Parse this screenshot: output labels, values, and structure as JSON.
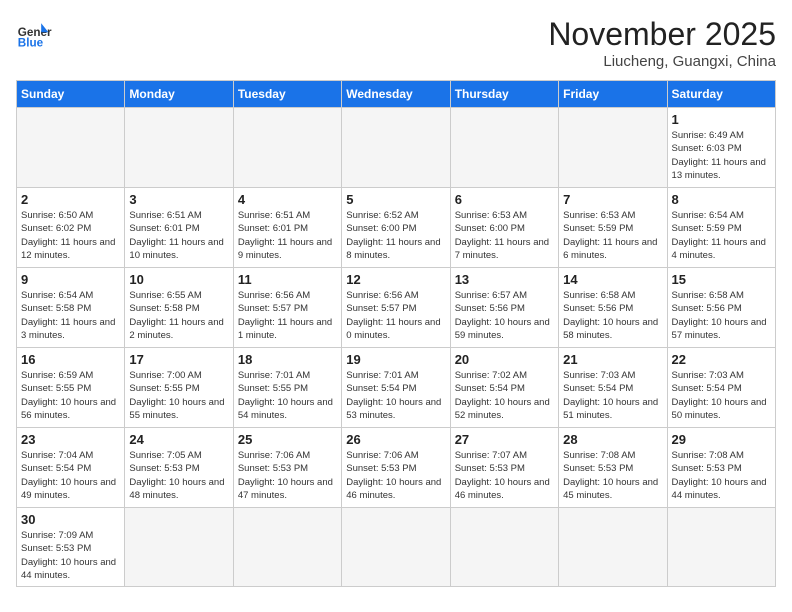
{
  "header": {
    "logo_general": "General",
    "logo_blue": "Blue",
    "month_year": "November 2025",
    "location": "Liucheng, Guangxi, China"
  },
  "weekdays": [
    "Sunday",
    "Monday",
    "Tuesday",
    "Wednesday",
    "Thursday",
    "Friday",
    "Saturday"
  ],
  "weeks": [
    [
      {
        "day": "",
        "empty": true
      },
      {
        "day": "",
        "empty": true
      },
      {
        "day": "",
        "empty": true
      },
      {
        "day": "",
        "empty": true
      },
      {
        "day": "",
        "empty": true
      },
      {
        "day": "",
        "empty": true
      },
      {
        "day": "1",
        "sunrise": "6:49 AM",
        "sunset": "6:03 PM",
        "daylight": "11 hours and 13 minutes."
      }
    ],
    [
      {
        "day": "2",
        "sunrise": "6:50 AM",
        "sunset": "6:02 PM",
        "daylight": "11 hours and 12 minutes."
      },
      {
        "day": "3",
        "sunrise": "6:51 AM",
        "sunset": "6:01 PM",
        "daylight": "11 hours and 10 minutes."
      },
      {
        "day": "4",
        "sunrise": "6:51 AM",
        "sunset": "6:01 PM",
        "daylight": "11 hours and 9 minutes."
      },
      {
        "day": "5",
        "sunrise": "6:52 AM",
        "sunset": "6:00 PM",
        "daylight": "11 hours and 8 minutes."
      },
      {
        "day": "6",
        "sunrise": "6:53 AM",
        "sunset": "6:00 PM",
        "daylight": "11 hours and 7 minutes."
      },
      {
        "day": "7",
        "sunrise": "6:53 AM",
        "sunset": "5:59 PM",
        "daylight": "11 hours and 6 minutes."
      },
      {
        "day": "8",
        "sunrise": "6:54 AM",
        "sunset": "5:59 PM",
        "daylight": "11 hours and 4 minutes."
      }
    ],
    [
      {
        "day": "9",
        "sunrise": "6:54 AM",
        "sunset": "5:58 PM",
        "daylight": "11 hours and 3 minutes."
      },
      {
        "day": "10",
        "sunrise": "6:55 AM",
        "sunset": "5:58 PM",
        "daylight": "11 hours and 2 minutes."
      },
      {
        "day": "11",
        "sunrise": "6:56 AM",
        "sunset": "5:57 PM",
        "daylight": "11 hours and 1 minute."
      },
      {
        "day": "12",
        "sunrise": "6:56 AM",
        "sunset": "5:57 PM",
        "daylight": "11 hours and 0 minutes."
      },
      {
        "day": "13",
        "sunrise": "6:57 AM",
        "sunset": "5:56 PM",
        "daylight": "10 hours and 59 minutes."
      },
      {
        "day": "14",
        "sunrise": "6:58 AM",
        "sunset": "5:56 PM",
        "daylight": "10 hours and 58 minutes."
      },
      {
        "day": "15",
        "sunrise": "6:58 AM",
        "sunset": "5:56 PM",
        "daylight": "10 hours and 57 minutes."
      }
    ],
    [
      {
        "day": "16",
        "sunrise": "6:59 AM",
        "sunset": "5:55 PM",
        "daylight": "10 hours and 56 minutes."
      },
      {
        "day": "17",
        "sunrise": "7:00 AM",
        "sunset": "5:55 PM",
        "daylight": "10 hours and 55 minutes."
      },
      {
        "day": "18",
        "sunrise": "7:01 AM",
        "sunset": "5:55 PM",
        "daylight": "10 hours and 54 minutes."
      },
      {
        "day": "19",
        "sunrise": "7:01 AM",
        "sunset": "5:54 PM",
        "daylight": "10 hours and 53 minutes."
      },
      {
        "day": "20",
        "sunrise": "7:02 AM",
        "sunset": "5:54 PM",
        "daylight": "10 hours and 52 minutes."
      },
      {
        "day": "21",
        "sunrise": "7:03 AM",
        "sunset": "5:54 PM",
        "daylight": "10 hours and 51 minutes."
      },
      {
        "day": "22",
        "sunrise": "7:03 AM",
        "sunset": "5:54 PM",
        "daylight": "10 hours and 50 minutes."
      }
    ],
    [
      {
        "day": "23",
        "sunrise": "7:04 AM",
        "sunset": "5:54 PM",
        "daylight": "10 hours and 49 minutes."
      },
      {
        "day": "24",
        "sunrise": "7:05 AM",
        "sunset": "5:53 PM",
        "daylight": "10 hours and 48 minutes."
      },
      {
        "day": "25",
        "sunrise": "7:06 AM",
        "sunset": "5:53 PM",
        "daylight": "10 hours and 47 minutes."
      },
      {
        "day": "26",
        "sunrise": "7:06 AM",
        "sunset": "5:53 PM",
        "daylight": "10 hours and 46 minutes."
      },
      {
        "day": "27",
        "sunrise": "7:07 AM",
        "sunset": "5:53 PM",
        "daylight": "10 hours and 46 minutes."
      },
      {
        "day": "28",
        "sunrise": "7:08 AM",
        "sunset": "5:53 PM",
        "daylight": "10 hours and 45 minutes."
      },
      {
        "day": "29",
        "sunrise": "7:08 AM",
        "sunset": "5:53 PM",
        "daylight": "10 hours and 44 minutes."
      }
    ],
    [
      {
        "day": "30",
        "sunrise": "7:09 AM",
        "sunset": "5:53 PM",
        "daylight": "10 hours and 44 minutes."
      },
      {
        "day": "",
        "empty": true
      },
      {
        "day": "",
        "empty": true
      },
      {
        "day": "",
        "empty": true
      },
      {
        "day": "",
        "empty": true
      },
      {
        "day": "",
        "empty": true
      },
      {
        "day": "",
        "empty": true
      }
    ]
  ]
}
